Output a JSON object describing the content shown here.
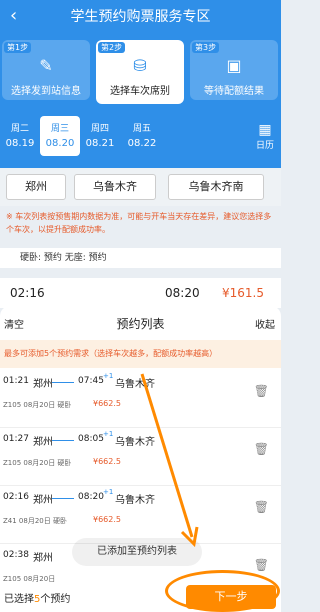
{
  "header": {
    "back": "‹",
    "title": "学生预约购票服务专区"
  },
  "steps": [
    {
      "tag": "第1步",
      "label": "选择发到站信息",
      "icon": "edit-icon"
    },
    {
      "tag": "第2步",
      "label": "选择车次席别",
      "icon": "seat-icon"
    },
    {
      "tag": "第3步",
      "label": "等待配额结果",
      "icon": "user-card-icon"
    }
  ],
  "dates": [
    {
      "week": "周二",
      "day": "08.19"
    },
    {
      "week": "周三",
      "day": "08.20"
    },
    {
      "week": "周四",
      "day": "08.21"
    },
    {
      "week": "周五",
      "day": "08.22"
    }
  ],
  "calendar": "日历",
  "stations": [
    "郑州",
    "乌鲁木齐",
    "乌鲁木齐南"
  ],
  "notice": "※ 车次列表按预售期内数据为准，可能与开车当天存在差异，建议您选择多个车次，以提升配额成功率。",
  "seatrow": "硬卧: 预约  无座: 预约",
  "background_train": {
    "dep": "02:16",
    "arr": "08:20",
    "price": "¥161.5"
  },
  "sheet": {
    "clear": "清空",
    "title": "预约列表",
    "collapse": "收起",
    "tip": "最多可添加5个预约需求（选择车次越多，配额成功率越高）"
  },
  "items": [
    {
      "dep": "01:21",
      "from": "郑州",
      "arr": "07:45",
      "plus": "+1",
      "to": "乌鲁木齐",
      "meta": "Z105 08月20日 硬卧",
      "price": "¥662.5"
    },
    {
      "dep": "01:27",
      "from": "郑州",
      "arr": "08:05",
      "plus": "+1",
      "to": "乌鲁木齐",
      "meta": "Z105 08月20日 硬卧",
      "price": "¥662.5"
    },
    {
      "dep": "02:16",
      "from": "郑州",
      "arr": "08:20",
      "plus": "+1",
      "to": "乌鲁木齐",
      "meta": "Z41 08月20日 硬卧",
      "price": "¥662.5"
    },
    {
      "dep": "02:38",
      "from": "郑州",
      "arr": "",
      "plus": "",
      "to": "",
      "meta": "Z105 08月20日",
      "price": ""
    }
  ],
  "toast": "已添加至预约列表",
  "footer": {
    "selected_prefix": "已选择",
    "count": "5",
    "selected_suffix": "个预约",
    "next": "下一步"
  },
  "colors": {
    "primary": "#2f8fe8",
    "accent": "#ff8a00",
    "warn": "#e65a2a"
  }
}
